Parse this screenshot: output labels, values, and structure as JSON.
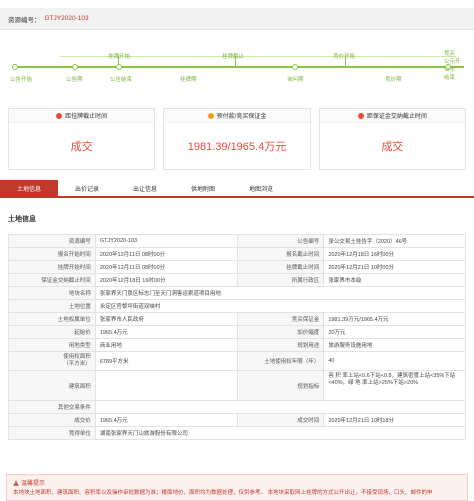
{
  "resource": {
    "label": "资源编号：",
    "code": "GTJY2020-103"
  },
  "timeline": {
    "top_labels": [
      "挂牌开始",
      "挂牌截止",
      "竞价开始"
    ],
    "bottom_labels": [
      "公告开始",
      "公告期",
      "公告结束",
      "挂牌期",
      "询问期",
      "竞价期"
    ],
    "right_labels": [
      "竞买",
      "公示开",
      "公示",
      "结束"
    ]
  },
  "cards": [
    {
      "title": "距挂牌截止时间",
      "value": "成交"
    },
    {
      "title": "预付款/竞买保证金",
      "value": "1981.39/1965.4万元"
    },
    {
      "title": "距保证金交纳截止时间",
      "value": "成交"
    }
  ],
  "tabs": [
    "土地信息",
    "出价记录",
    "出让信息",
    "供地附图",
    "地图浏览"
  ],
  "section_title": "土地信息",
  "fields": {
    "r1": {
      "k1": "资源编号",
      "v1": "GTJY2020-103",
      "k2": "公告编号",
      "v2": "张公交易土挂告字（2020）46号"
    },
    "r2": {
      "k1": "报名开始时间",
      "v1": "2020年12月11日 08时00分",
      "k2": "报名截止时间",
      "v2": "2020年12月18日 16时00分"
    },
    "r3": {
      "k1": "挂牌开始时间",
      "v1": "2020年12月11日 08时00分",
      "k2": "挂牌截止时间",
      "v2": "2020年12月21日 10时00分"
    },
    "r4": {
      "k1": "保证金交纳截止时间",
      "v1": "2020年12月18日 16时00分",
      "k2": "所属行政区",
      "v2": "张家界市本级"
    },
    "r5": {
      "k1": "地块名称",
      "v1": "张家界天门景区标志门至天门洞客运索道项目用地"
    },
    "r6": {
      "k1": "土地位置",
      "v1": "永定区官黎坪街道双峡村"
    },
    "r7": {
      "k1": "土地权属单位",
      "v1": "张家界市人民政府",
      "k2": "竞买保证金",
      "v2": "1981.39万元/1965.4万元"
    },
    "r8": {
      "k1": "起始价",
      "v1": "1965.4万元",
      "k2": "加价幅度",
      "v2": "20万元"
    },
    "r9": {
      "k1": "用地类型",
      "v1": "商业用地",
      "k2": "规划用途",
      "v2": "旅游服务设施用地"
    },
    "r10": {
      "k1": "使用权面积\n（平方米）",
      "v1": "6789平方米",
      "k2": "土地使用权年限（年）",
      "v2": "40"
    },
    "r11": {
      "k1": "建筑面积",
      "v1": "",
      "k2": "规划指标",
      "v2": "容 积 率上站<0.6下站<0.8，建筑密度上站<35%下站<40%，绿 地 率上站>25%下站>20%"
    },
    "r12": {
      "k1": "其他交易条件",
      "v1": ""
    },
    "r13": {
      "k1": "成交价",
      "v1": "1965.4万元",
      "k2": "成交时间",
      "v2": "2020年12月21日 10时18分"
    },
    "r14": {
      "k1": "竞得单位",
      "v1": "湖南张家界天门山旅游股份有限公司"
    }
  },
  "notice": {
    "title": "温馨提示",
    "body": "本地块土地面积、建筑面积、容积率以及操作审批数据为准；楼面地价、面积均为数据处理，仅供参考。   本地块采取网上挂牌的方式公开出让，不接受现场、口头、邮件的申"
  },
  "colors": {
    "accent": "#c0392b",
    "timeline": "#8cc63f"
  }
}
